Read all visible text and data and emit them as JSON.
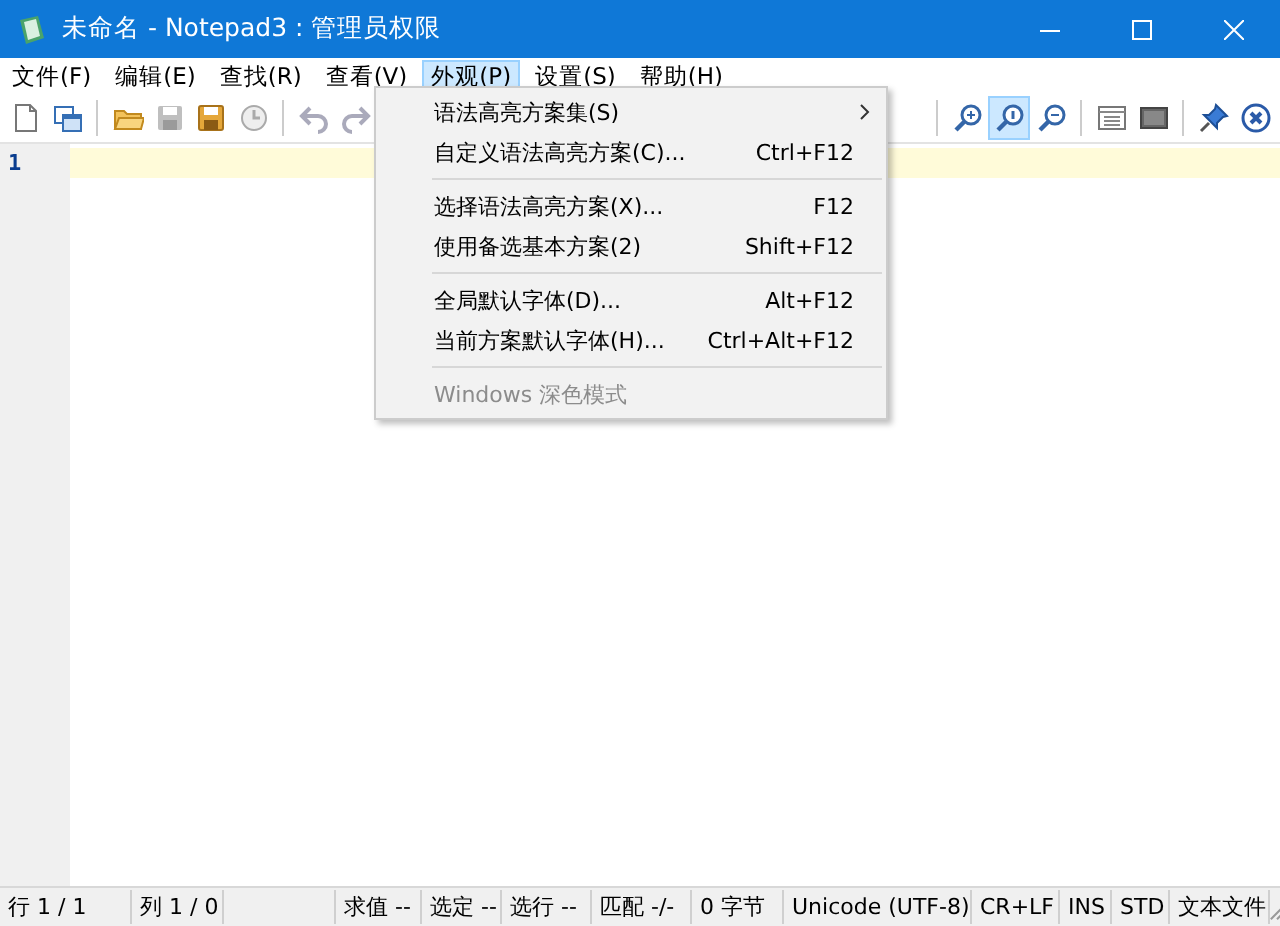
{
  "window": {
    "title": "未命名 - Notepad3 : 管理员权限"
  },
  "menu_bar": [
    {
      "label": "文件(F)",
      "selected": false
    },
    {
      "label": "编辑(E)",
      "selected": false
    },
    {
      "label": "查找(R)",
      "selected": false
    },
    {
      "label": "查看(V)",
      "selected": false
    },
    {
      "label": "外观(P)",
      "selected": true
    },
    {
      "label": "设置(S)",
      "selected": false
    },
    {
      "label": "帮助(H)",
      "selected": false
    }
  ],
  "toolbar_left": [
    {
      "kind": "new",
      "selected": false
    },
    {
      "kind": "windows",
      "selected": false
    },
    {
      "kind": "sep"
    },
    {
      "kind": "open",
      "selected": false
    },
    {
      "kind": "save",
      "selected": false
    },
    {
      "kind": "saveas",
      "selected": false
    },
    {
      "kind": "history",
      "selected": false
    },
    {
      "kind": "sep"
    },
    {
      "kind": "undo",
      "selected": false
    },
    {
      "kind": "redo",
      "selected": false
    }
  ],
  "toolbar_right": [
    {
      "kind": "sep"
    },
    {
      "kind": "zoomin",
      "selected": false
    },
    {
      "kind": "zoomreset",
      "selected": true
    },
    {
      "kind": "zoomout",
      "selected": false
    },
    {
      "kind": "sep"
    },
    {
      "kind": "panel",
      "selected": false
    },
    {
      "kind": "screen",
      "selected": false
    },
    {
      "kind": "sep"
    },
    {
      "kind": "pin",
      "selected": false
    },
    {
      "kind": "exit",
      "selected": false
    }
  ],
  "editor": {
    "line_numbers": [
      "1"
    ]
  },
  "dropdown_menu": {
    "groups": [
      [
        {
          "label": "语法高亮方案集(S)",
          "submenu": true,
          "disabled": false
        },
        {
          "label": "自定义语法高亮方案(C)...",
          "shortcut": "Ctrl+F12",
          "submenu": false,
          "disabled": false
        }
      ],
      [
        {
          "label": "选择语法高亮方案(X)...",
          "shortcut": "F12",
          "submenu": false,
          "disabled": false
        },
        {
          "label": "使用备选基本方案(2)",
          "shortcut": "Shift+F12",
          "submenu": false,
          "disabled": false
        }
      ],
      [
        {
          "label": "全局默认字体(D)...",
          "shortcut": "Alt+F12",
          "submenu": false,
          "disabled": false
        },
        {
          "label": "当前方案默认字体(H)...",
          "shortcut": "Ctrl+Alt+F12",
          "submenu": false,
          "disabled": false
        }
      ],
      [
        {
          "label": "Windows 深色模式",
          "submenu": false,
          "disabled": true
        }
      ]
    ]
  },
  "status_bar": [
    "行  1 / 1",
    "列  1 / 0",
    "求值  --",
    "选定  --",
    "选行  --",
    "匹配  -/-",
    "0 字节",
    "Unicode (UTF-8)",
    "CR+LF",
    "INS",
    "STD",
    "文本文件"
  ]
}
